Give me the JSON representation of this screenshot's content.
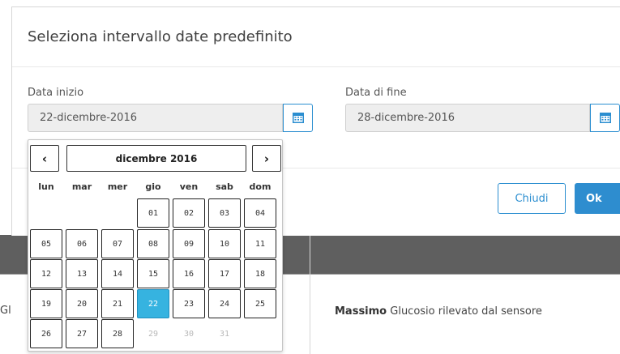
{
  "modal": {
    "title": "Seleziona intervallo date predefinito",
    "start": {
      "label": "Data inizio",
      "value": "22-dicembre-2016",
      "icon": "calendar-icon"
    },
    "end": {
      "label": "Data di fine",
      "value": "28-dicembre-2016",
      "icon": "calendar-icon"
    },
    "buttons": {
      "close": "Chiudi",
      "ok": "Ok"
    }
  },
  "datepicker": {
    "prev": "‹",
    "next": "›",
    "title": "dicembre 2016",
    "weekdays": [
      "lun",
      "mar",
      "mer",
      "gio",
      "ven",
      "sab",
      "dom"
    ],
    "days": [
      [
        "",
        "",
        "",
        "01",
        "02",
        "03",
        "04"
      ],
      [
        "05",
        "06",
        "07",
        "08",
        "09",
        "10",
        "11"
      ],
      [
        "12",
        "13",
        "14",
        "15",
        "16",
        "17",
        "18"
      ],
      [
        "19",
        "20",
        "21",
        "22",
        "23",
        "24",
        "25"
      ],
      [
        "26",
        "27",
        "28",
        "29",
        "30",
        "31",
        ""
      ]
    ],
    "selected": "22",
    "disabled": [
      "29",
      "30",
      "31"
    ],
    "selected_color": "#36b3e0"
  },
  "background": {
    "left_fragment": "Gl",
    "right_bold": "Massimo",
    "right_text": " Glucosio rilevato dal sensore"
  },
  "colors": {
    "accent": "#2b8ed0",
    "ok_button": "#2e8dcf"
  }
}
